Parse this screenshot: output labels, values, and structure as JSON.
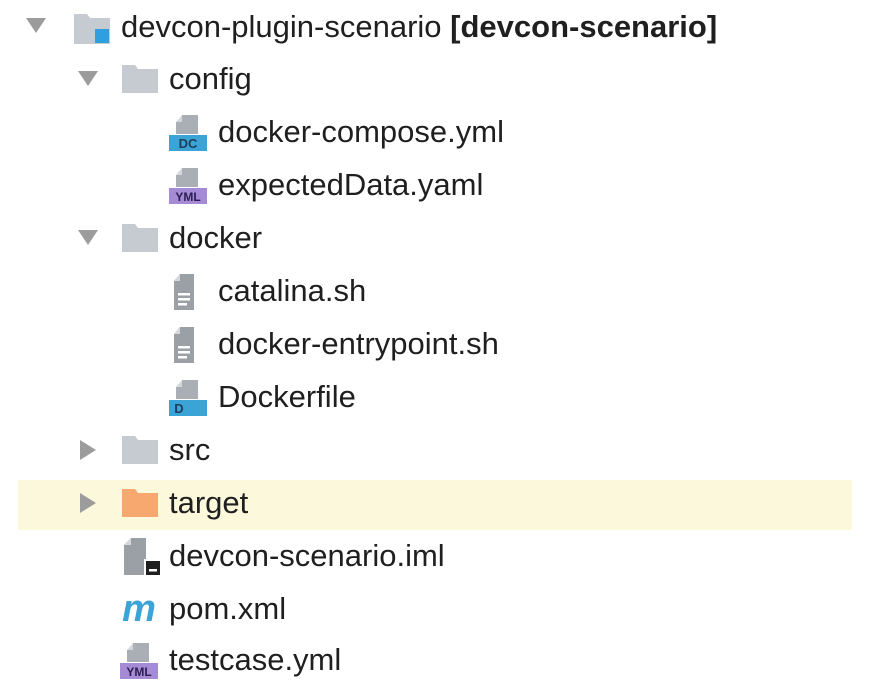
{
  "tree": {
    "root": {
      "name": "devcon-plugin-scenario",
      "module": "[devcon-scenario]",
      "expanded": true,
      "icon": "module-folder-icon"
    },
    "items": [
      {
        "label": "config",
        "type": "folder",
        "expanded": true,
        "icon": "folder-icon"
      },
      {
        "label": "docker-compose.yml",
        "type": "file",
        "icon": "docker-compose-file-icon",
        "badge": "DC"
      },
      {
        "label": "expectedData.yaml",
        "type": "file",
        "icon": "yaml-file-icon",
        "badge": "YML"
      },
      {
        "label": "docker",
        "type": "folder",
        "expanded": true,
        "icon": "folder-icon"
      },
      {
        "label": "catalina.sh",
        "type": "file",
        "icon": "text-file-icon"
      },
      {
        "label": "docker-entrypoint.sh",
        "type": "file",
        "icon": "text-file-icon"
      },
      {
        "label": "Dockerfile",
        "type": "file",
        "icon": "dockerfile-icon",
        "badge": "D"
      },
      {
        "label": "src",
        "type": "folder",
        "expanded": false,
        "icon": "folder-icon"
      },
      {
        "label": "target",
        "type": "folder",
        "expanded": false,
        "icon": "excluded-folder-icon",
        "selected": true
      },
      {
        "label": "devcon-scenario.iml",
        "type": "file",
        "icon": "iml-file-icon"
      },
      {
        "label": "pom.xml",
        "type": "file",
        "icon": "maven-icon",
        "badge": "m"
      },
      {
        "label": "testcase.yml",
        "type": "file",
        "icon": "yaml-file-icon",
        "badge": "YML"
      }
    ]
  },
  "colors": {
    "folder": "#c5cbd1",
    "excluded_folder": "#f6a86e",
    "module_accent": "#2f9fe0",
    "dc_badge": "#3ba3d6",
    "yml_badge": "#a58ad6",
    "selection": "#fcf8dc",
    "arrow": "#9c9c9c"
  }
}
